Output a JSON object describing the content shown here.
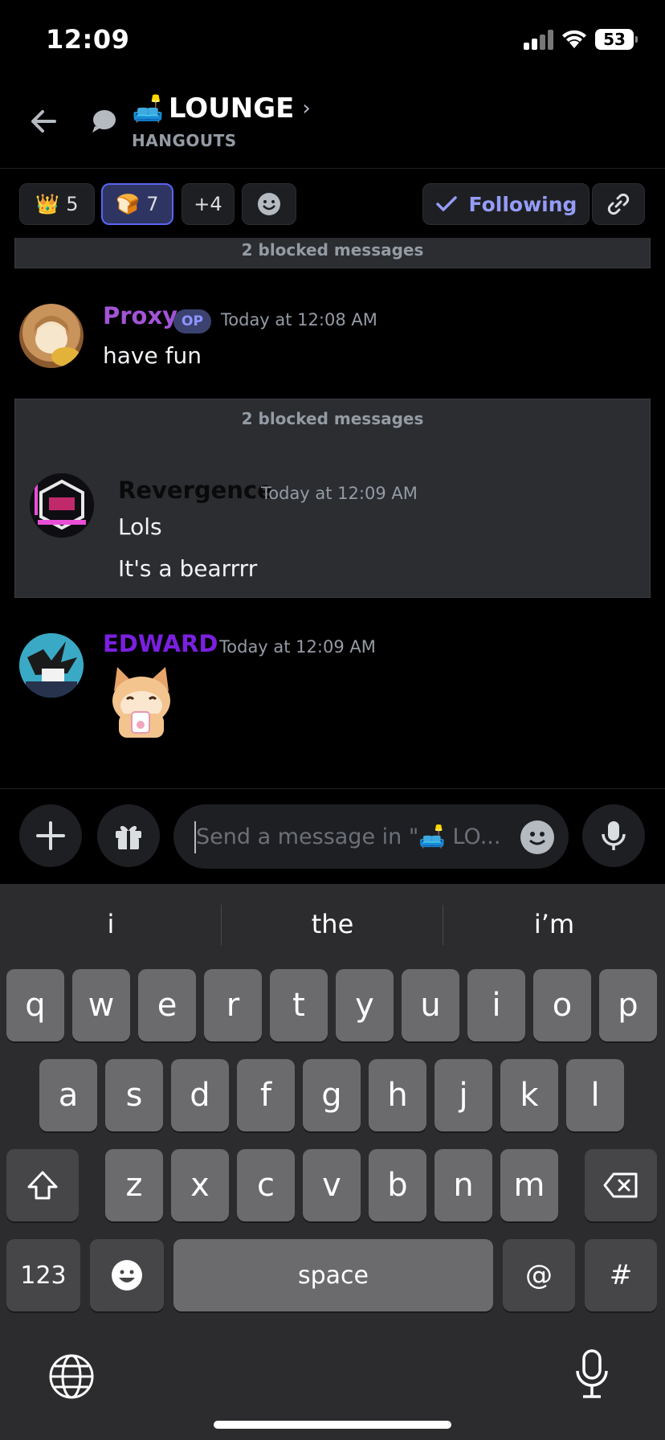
{
  "status_bar": {
    "time": "12:09",
    "battery": "53"
  },
  "header": {
    "channel_emoji": "🛋️",
    "channel_name": "LOUNGE",
    "chevron": "›",
    "category": "HANGOUTS"
  },
  "chips": [
    {
      "emoji": "👑",
      "count": "5",
      "selected": false
    },
    {
      "emoji": "🍞",
      "count": "7",
      "selected": true
    },
    {
      "label": "+4"
    }
  ],
  "following_label": "Following",
  "messages": {
    "blocked_top": "2 blocked messages",
    "proxy": {
      "username": "Proxy",
      "badge": "OP",
      "timestamp": "Today at 12:08 AM",
      "text": "have fun",
      "color": "#a254d6"
    },
    "blocked_group": {
      "label": "2 blocked messages",
      "username": "Revergence",
      "timestamp": "Today at 12:09 AM",
      "lines": [
        "Lols",
        "It's a bearrrr"
      ]
    },
    "edward": {
      "username": "EDWARD",
      "timestamp": "Today at 12:09 AM",
      "sticker": "cat-sticker",
      "color": "#7b1fe0"
    }
  },
  "composer": {
    "placeholder": "Send a message in \"🛋️ LO..."
  },
  "keyboard": {
    "suggestions": [
      "i",
      "the",
      "i’m"
    ],
    "row1": [
      "q",
      "w",
      "e",
      "r",
      "t",
      "y",
      "u",
      "i",
      "o",
      "p"
    ],
    "row2": [
      "a",
      "s",
      "d",
      "f",
      "g",
      "h",
      "j",
      "k",
      "l"
    ],
    "row3": [
      "z",
      "x",
      "c",
      "v",
      "b",
      "n",
      "m"
    ],
    "numbers_key": "123",
    "space_key": "space",
    "at_key": "@",
    "hash_key": "#"
  }
}
